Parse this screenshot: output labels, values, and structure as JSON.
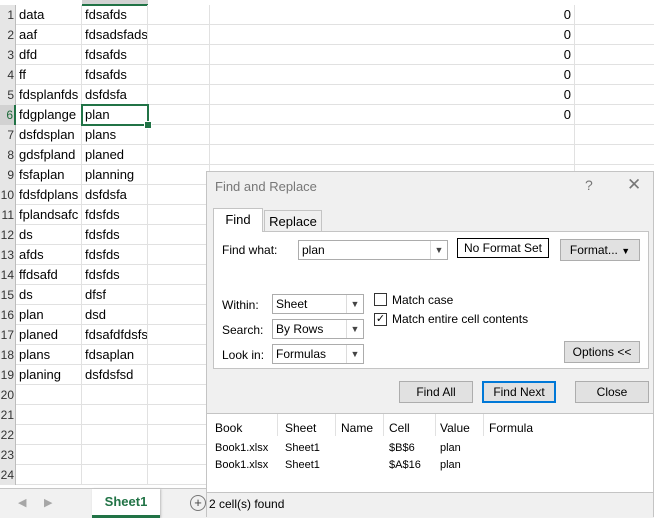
{
  "sheet": {
    "rows": [
      {
        "num": "1",
        "a": "data",
        "b": "fdsafds",
        "d": "0"
      },
      {
        "num": "2",
        "a": "aaf",
        "b": "fdsadsfadsfds",
        "d": "0"
      },
      {
        "num": "3",
        "a": "dfd",
        "b": "fdsafds",
        "d": "0"
      },
      {
        "num": "4",
        "a": "ff",
        "b": "fdsafds",
        "d": "0"
      },
      {
        "num": "5",
        "a": "fdsplanfds",
        "b": "dsfdsfa",
        "d": "0"
      },
      {
        "num": "6",
        "a": "fdgplange",
        "b": "plan",
        "d": "0"
      },
      {
        "num": "7",
        "a": "dsfdsplan",
        "b": "plans",
        "d": ""
      },
      {
        "num": "8",
        "a": "gdsfpland",
        "b": "planed",
        "d": ""
      },
      {
        "num": "9",
        "a": "fsfaplan",
        "b": "planning",
        "d": ""
      },
      {
        "num": "10",
        "a": "fdsfdplans",
        "b": "dsfdsfa",
        "d": ""
      },
      {
        "num": "11",
        "a": "fplandsafc",
        "b": "fdsfds",
        "d": ""
      },
      {
        "num": "12",
        "a": "ds",
        "b": "fdsfds",
        "d": ""
      },
      {
        "num": "13",
        "a": "afds",
        "b": "fdsfds",
        "d": ""
      },
      {
        "num": "14",
        "a": "ffdsafd",
        "b": "fdsfds",
        "d": ""
      },
      {
        "num": "15",
        "a": "ds",
        "b": "dfsf",
        "d": ""
      },
      {
        "num": "16",
        "a": "plan",
        "b": "dsd",
        "d": ""
      },
      {
        "num": "17",
        "a": "planed",
        "b": "fdsafdfdsfs",
        "d": ""
      },
      {
        "num": "18",
        "a": "plans",
        "b": "fdsaplan",
        "d": ""
      },
      {
        "num": "19",
        "a": "planing",
        "b": "dsfdsfsd",
        "d": ""
      },
      {
        "num": "20",
        "a": "",
        "b": "",
        "d": ""
      },
      {
        "num": "21",
        "a": "",
        "b": "",
        "d": ""
      },
      {
        "num": "22",
        "a": "",
        "b": "",
        "d": ""
      },
      {
        "num": "23",
        "a": "",
        "b": "",
        "d": ""
      },
      {
        "num": "24",
        "a": "",
        "b": "",
        "d": ""
      }
    ],
    "tab_name": "Sheet1",
    "add_sheet": "+",
    "nav_prev": "◀",
    "nav_next": "▶"
  },
  "dialog": {
    "title": "Find and Replace",
    "help": "?",
    "close": "✕",
    "tabs": {
      "find": "Find",
      "replace": "Replace"
    },
    "find_what_label": "Find what:",
    "find_what_value": "plan",
    "no_format": "No Format Set",
    "format_btn": "Format...",
    "within_label": "Within:",
    "within_value": "Sheet",
    "search_label": "Search:",
    "search_value": "By Rows",
    "lookin_label": "Look in:",
    "lookin_value": "Formulas",
    "match_case": "Match case",
    "match_entire": "Match entire cell contents",
    "options_btn": "Options <<",
    "find_all": "Find All",
    "find_next": "Find Next",
    "close_btn": "Close",
    "results": {
      "headers": [
        "Book",
        "Sheet",
        "Name",
        "Cell",
        "Value",
        "Formula"
      ],
      "rows": [
        [
          "Book1.xlsx",
          "Sheet1",
          "",
          "$B$6",
          "plan",
          ""
        ],
        [
          "Book1.xlsx",
          "Sheet1",
          "",
          "$A$16",
          "plan",
          ""
        ]
      ]
    },
    "status": "2 cell(s) found"
  },
  "colors": {
    "accent": "#217346",
    "focus": "#0078d7"
  }
}
